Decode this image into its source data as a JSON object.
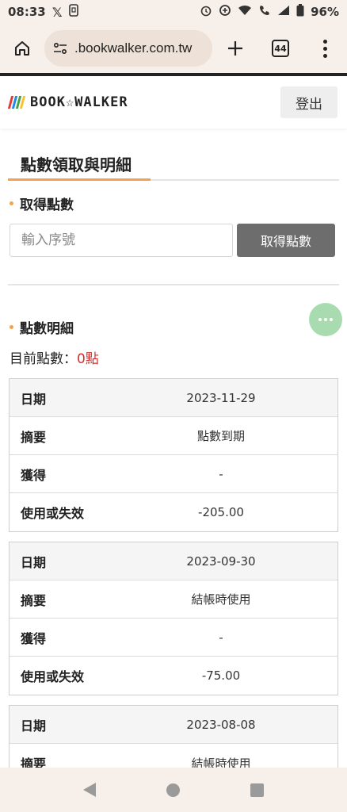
{
  "status_bar": {
    "time": "08:33",
    "battery": "96%",
    "icons": [
      "x-app-icon",
      "screenshot-icon",
      "alarm-icon",
      "data-saver-icon",
      "wifi-icon",
      "wifi-call-icon",
      "signal-icon",
      "battery-icon"
    ]
  },
  "browser": {
    "url": ".bookwalker.com.tw",
    "tab_count": "44"
  },
  "header": {
    "logo_text": "BOOK☆WALKER",
    "logo_stripe_colors": [
      "#e53935",
      "#1e88e5",
      "#43a047",
      "#fbc02d"
    ],
    "logout_label": "登出"
  },
  "page": {
    "title": "點數領取與明細",
    "accent_color": "#f2a24c",
    "redeem_section": {
      "heading": "取得點數",
      "input_placeholder": "輸入序號",
      "button_label": "取得點數"
    },
    "details_section": {
      "heading": "點數明細",
      "current_points_label": "目前點數：",
      "current_points_value": "0點"
    },
    "records": [
      {
        "rows": [
          {
            "label": "日期",
            "value": "2023-11-29"
          },
          {
            "label": "摘要",
            "value": "點數到期"
          },
          {
            "label": "獲得",
            "value": "-"
          },
          {
            "label": "使用或失效",
            "value": "-205.00"
          }
        ]
      },
      {
        "rows": [
          {
            "label": "日期",
            "value": "2023-09-30"
          },
          {
            "label": "摘要",
            "value": "結帳時使用"
          },
          {
            "label": "獲得",
            "value": "-"
          },
          {
            "label": "使用或失效",
            "value": "-75.00"
          }
        ]
      },
      {
        "rows": [
          {
            "label": "日期",
            "value": "2023-08-08"
          },
          {
            "label": "摘要",
            "value": "結帳時使用"
          }
        ]
      }
    ]
  }
}
